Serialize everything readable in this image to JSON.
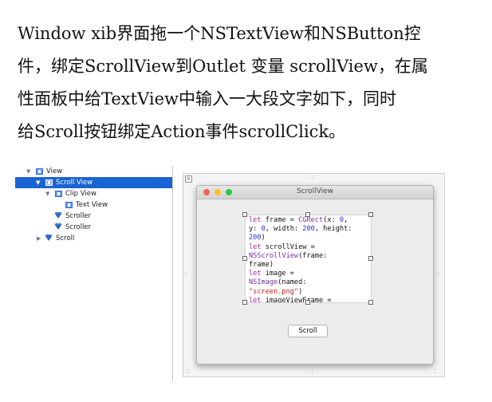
{
  "paragraph": {
    "lines": [
      "Window xib界面拖一个NSTextView和NSButton控",
      "件，绑定ScrollView到Outlet 变量 scrollView，在属",
      "性面板中给TextView中输入一大段文字如下，同时",
      "给Scroll按钮绑定Action事件scrollClick。"
    ]
  },
  "outline": {
    "items": [
      {
        "label": "View",
        "icon": "view-icon",
        "disclosure": "expanded"
      },
      {
        "label": "Scroll View",
        "icon": "view-icon",
        "disclosure": "expanded",
        "selected": true
      },
      {
        "label": "Clip View",
        "icon": "view-icon",
        "disclosure": "expanded"
      },
      {
        "label": "Text View",
        "icon": "view-icon",
        "disclosure": "none"
      },
      {
        "label": "Scroller",
        "icon": "scroller-icon",
        "disclosure": "none"
      },
      {
        "label": "Scroller",
        "icon": "scroller-icon",
        "disclosure": "none"
      },
      {
        "label": "Scroll",
        "icon": "button-icon",
        "disclosure": "collapsed"
      }
    ],
    "selection_color": "#1a63d2"
  },
  "window": {
    "title": "ScrollView",
    "traffic_lights": {
      "close": "#fc5f57",
      "minimize": "#fdbc2e",
      "zoom": "#28c840"
    },
    "text_view": {
      "code_lines": [
        "let frame = CGRect(x: 0,",
        "y: 0, width: 200, height:",
        "200)",
        "let scrollView =",
        "NSScrollView(frame:",
        "frame)",
        "let image =",
        "NSImage(named:",
        "\"screen.png\")",
        "let imageViewFrame ="
      ],
      "syntax_colors": {
        "keyword": "#a12a98",
        "type": "#7a2fae",
        "number": "#2433d0",
        "string": "#c51b1b"
      }
    },
    "button_label": "Scroll"
  }
}
